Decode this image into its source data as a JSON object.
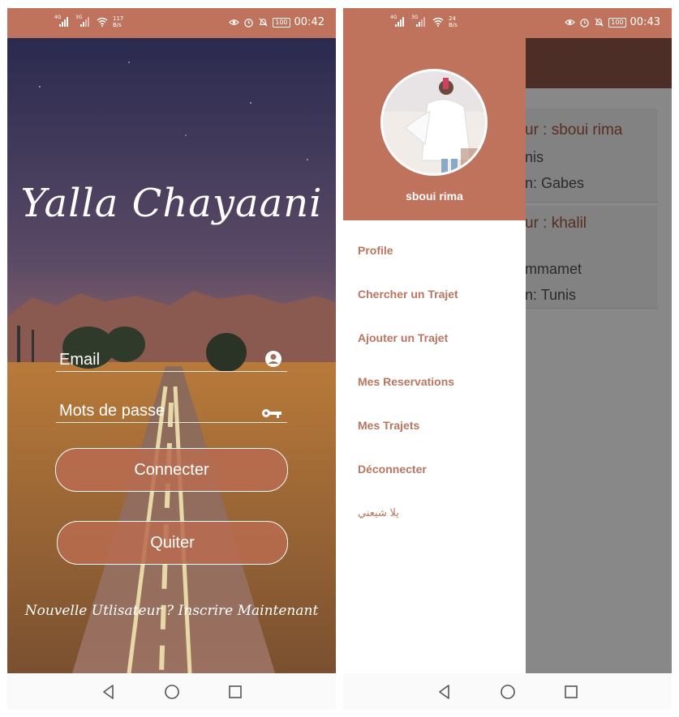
{
  "left_screen": {
    "status": {
      "net1": "4G",
      "net2": "3G",
      "speed_value": "117",
      "speed_unit": "B/s",
      "battery": "100",
      "time": "00:42"
    },
    "app_title": "Yalla Chayaani",
    "email_placeholder": "Email",
    "password_placeholder": "Mots de passe",
    "connect_label": "Connecter",
    "quit_label": "Quiter",
    "signup_text": "Nouvelle Utlisateur ? Inscrire Maintenant"
  },
  "right_screen": {
    "status": {
      "net1": "4G",
      "net2": "3G",
      "speed_value": "24",
      "speed_unit": "B/s",
      "battery": "100",
      "time": "00:43"
    },
    "drawer": {
      "user_name": "sboui rima",
      "menu": [
        "Profile",
        "Chercher un Trajet",
        "Ajouter un Trajet",
        "Mes Reservations",
        "Mes Trajets",
        "Déconnecter",
        "يلا شيعني"
      ]
    },
    "background_cards": [
      {
        "line1": "ur : sboui rima",
        "line2": "nis",
        "line3": "n: Gabes"
      },
      {
        "line1": "ur : khalil",
        "line2": "mmamet",
        "line3": "n: Tunis"
      }
    ]
  },
  "colors": {
    "accent": "#bf735d",
    "appbar": "#7a4a3e",
    "menu_text": "#b97560"
  },
  "icons": [
    "signal-icon",
    "wifi-icon",
    "eye-icon",
    "alarm-icon",
    "bell-off-icon",
    "battery-icon",
    "user-circle-icon",
    "key-icon",
    "back-icon",
    "home-icon",
    "recents-icon"
  ]
}
